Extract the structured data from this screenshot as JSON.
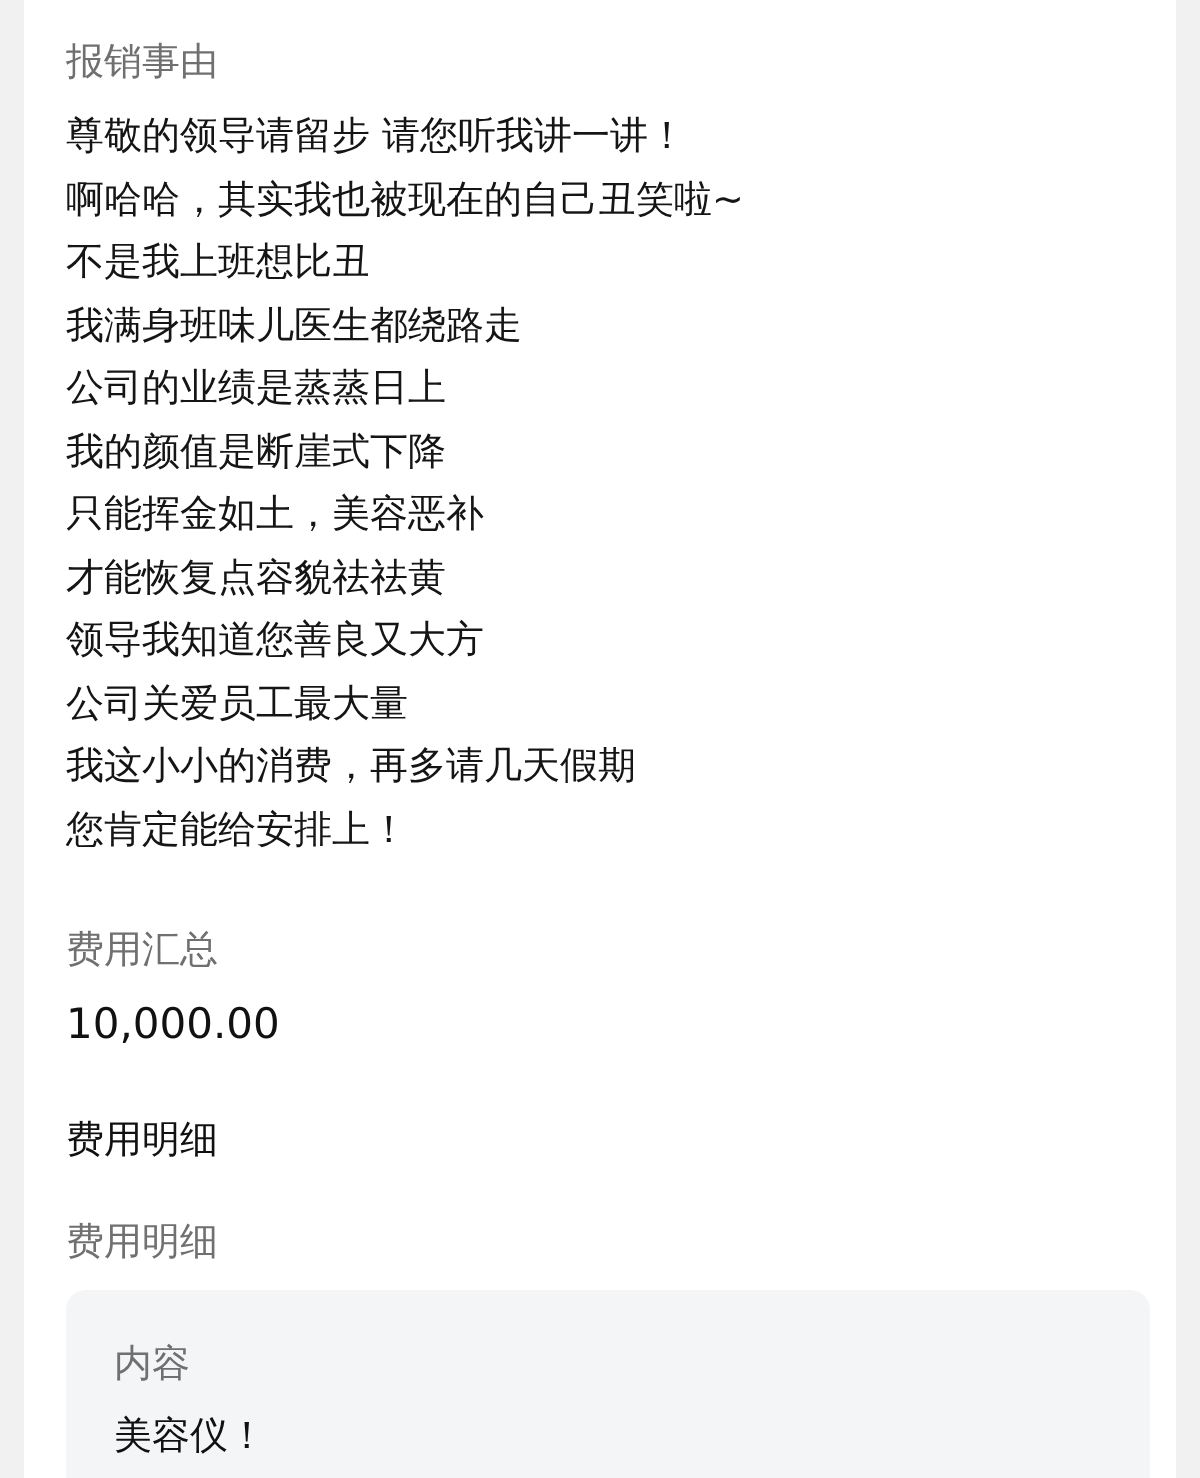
{
  "reason": {
    "label": "报销事由",
    "lines": [
      "尊敬的领导请留步 请您听我讲一讲！",
      "啊哈哈，其实我也被现在的自己丑笑啦~",
      "不是我上班想比丑",
      "我满身班味儿医生都绕路走",
      "公司的业绩是蒸蒸日上",
      "我的颜值是断崖式下降",
      "只能挥金如土，美容恶补",
      "才能恢复点容貌祛祛黄",
      "领导我知道您善良又大方",
      "公司关爱员工最大量",
      "我这小小的消费，再多请几天假期",
      "您肯定能给安排上！"
    ]
  },
  "summary": {
    "label": "费用汇总",
    "value": "10,000.00"
  },
  "details": {
    "title": "费用明细",
    "label": "费用明细",
    "items": [
      {
        "label": "内容",
        "value": "美容仪！"
      }
    ]
  }
}
